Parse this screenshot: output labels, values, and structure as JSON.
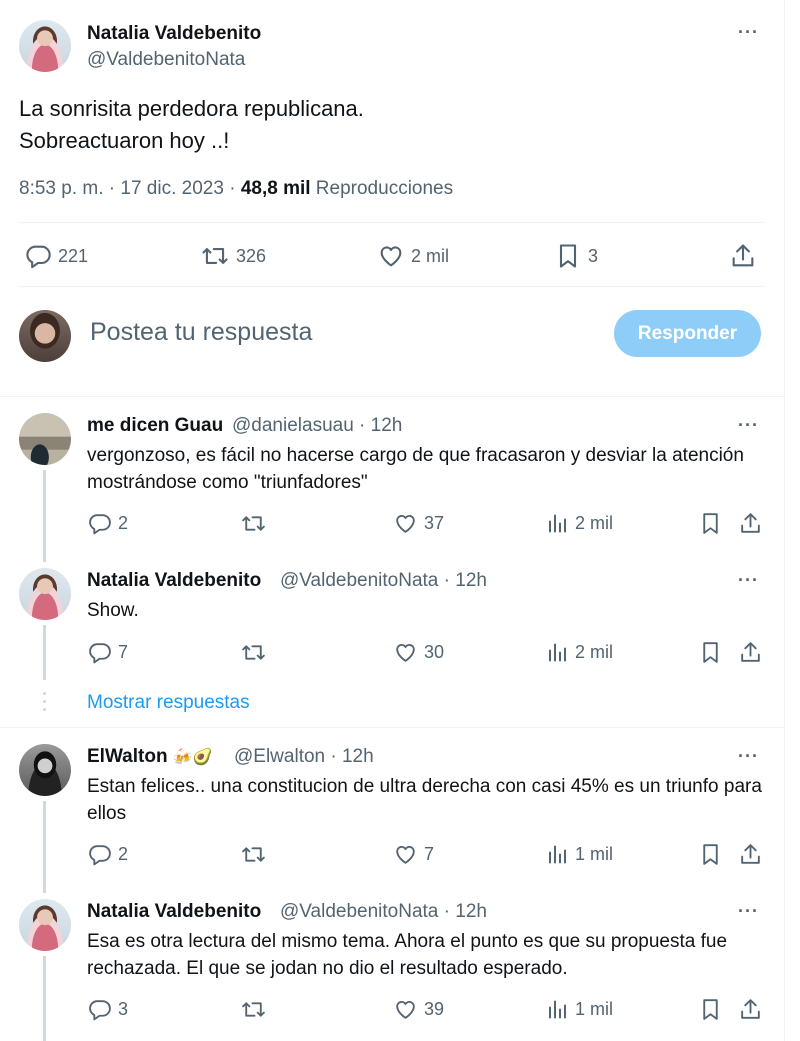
{
  "main_tweet": {
    "author_name": "Natalia Valdebenito",
    "author_handle": "@ValdebenitoNata",
    "text_line1": "La sonrisita perdedora republicana.",
    "text_line2": "Sobreactuaron hoy ..!",
    "time": "8:53 p. m.",
    "sep1": " · ",
    "date": "17 dic. 2023",
    "sep2": " · ",
    "views_count": "48,8 mil",
    "views_label": " Reproducciones",
    "replies": "221",
    "retweets": "326",
    "likes": "2 mil",
    "bookmarks": "3",
    "more": "···"
  },
  "reply_composer": {
    "placeholder": "Postea tu respuesta",
    "button_label": "Responder"
  },
  "show_replies_label": "Mostrar respuestas",
  "replies": [
    {
      "name": "me dicen Guau",
      "handle_time": "@danielasuau · 12h",
      "text": "vergonzoso, es fácil no hacerse cargo de que fracasaron y desviar la atención mostrándose como \"triunfadores\"",
      "replies": "2",
      "likes": "37",
      "views": "2 mil"
    },
    {
      "name": "Natalia Valdebenito",
      "handle_time": "@ValdebenitoNata · 12h",
      "text": "Show.",
      "replies": "7",
      "likes": "30",
      "views": "2 mil"
    },
    {
      "name": "ElWalton",
      "emojis": "🍻🥑",
      "handle_time": "@Elwalton · 12h",
      "text": "Estan felices.. una constitucion de ultra derecha con casi 45% es un triunfo para ellos",
      "replies": "2",
      "likes": "7",
      "views": "1 mil"
    },
    {
      "name": "Natalia Valdebenito",
      "handle_time": "@ValdebenitoNata · 12h",
      "text": "Esa es otra lectura del mismo tema. Ahora el punto es que su propuesta fue rechazada. El que se jodan no dio el resultado esperado.",
      "replies": "3",
      "likes": "39",
      "views": "1 mil"
    }
  ],
  "icons": {
    "reply": "reply-bubble-icon",
    "retweet": "retweet-icon",
    "like": "heart-icon",
    "bookmark": "bookmark-icon",
    "share": "share-icon",
    "views": "views-bars-icon",
    "more": "more-dots-icon"
  },
  "colors": {
    "text": "#0f1419",
    "secondary": "#536471",
    "accent": "#1d9bf0",
    "button_disabled": "#8ecdf8",
    "divider": "#eff3f4",
    "thread_line": "#cfd9de"
  }
}
